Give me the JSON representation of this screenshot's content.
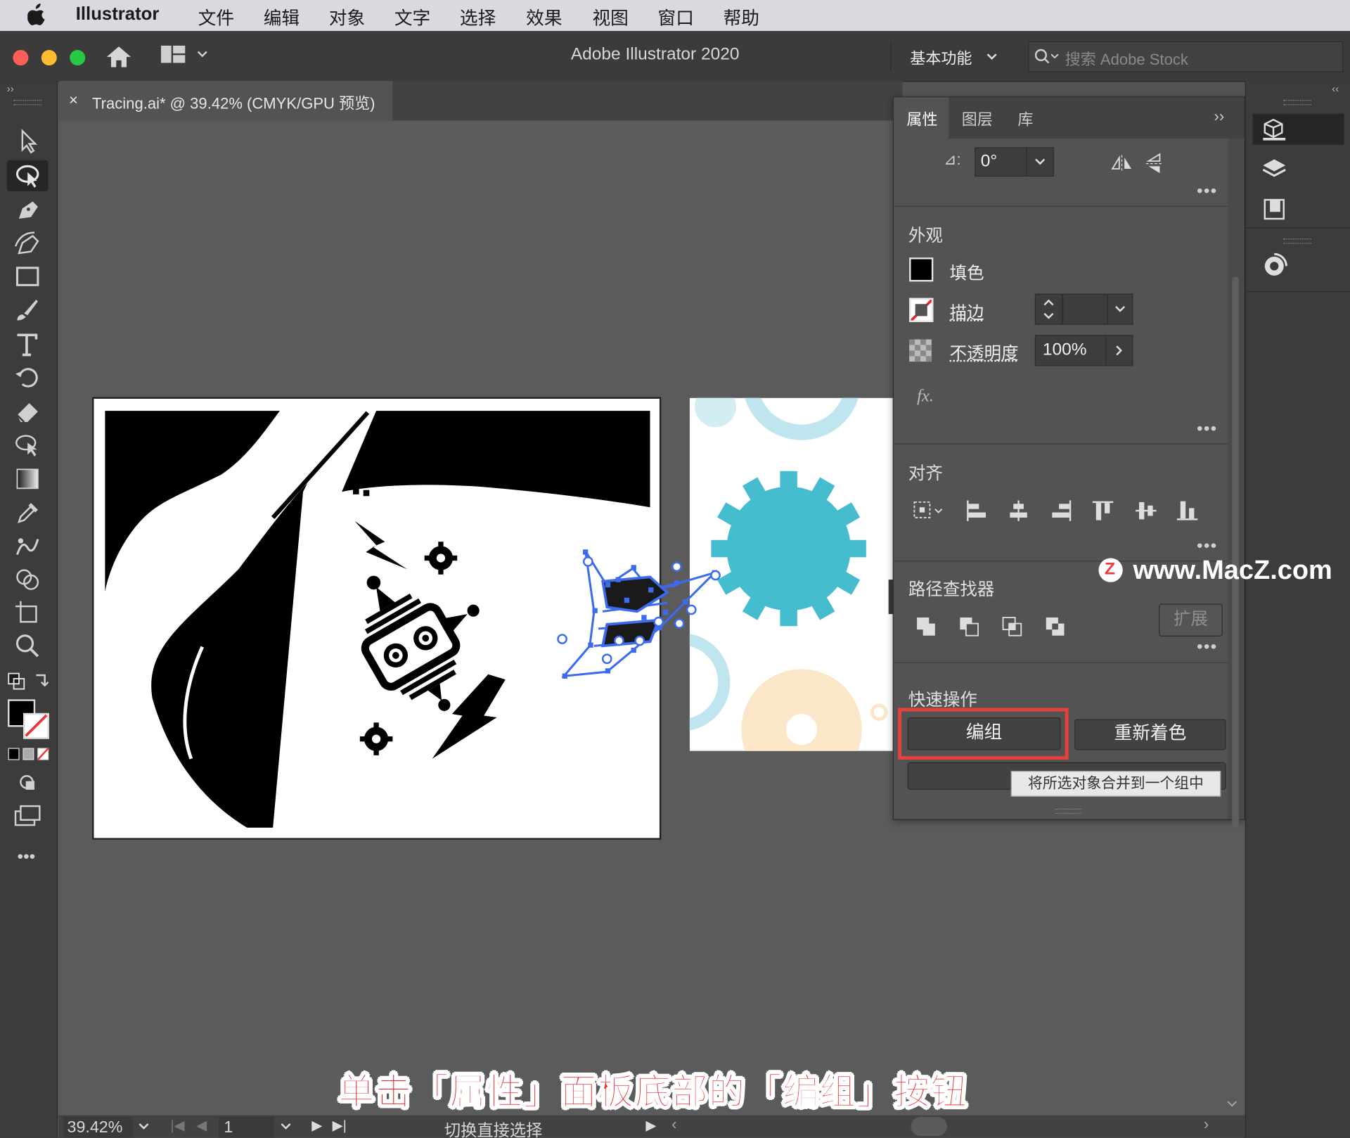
{
  "menubar": {
    "app_name": "Illustrator",
    "items": [
      "文件",
      "编辑",
      "对象",
      "文字",
      "选择",
      "效果",
      "视图",
      "窗口",
      "帮助"
    ]
  },
  "titlebar": {
    "window_title": "Adobe Illustrator 2020",
    "workspace": "基本功能",
    "search_placeholder": "搜索 Adobe Stock"
  },
  "document_tab": {
    "close_symbol": "×",
    "title": "Tracing.ai* @ 39.42% (CMYK/GPU 预览)"
  },
  "properties_panel": {
    "tabs": [
      "属性",
      "图层",
      "库"
    ],
    "active_tab": "属性",
    "rotate_symbol": "⊿:",
    "rotate_value": "0°",
    "appearance": {
      "title": "外观",
      "fill_label": "填色",
      "stroke_label": "描边",
      "opacity_label": "不透明度",
      "opacity_value": "100%",
      "fx_label": "fx."
    },
    "align": {
      "title": "对齐"
    },
    "pathfinder": {
      "title": "路径查找器",
      "expand_label": "扩展"
    },
    "quick_actions": {
      "title": "快速操作",
      "group_button": "编组",
      "recolor_button": "重新着色",
      "tooltip": "将所选对象合并到一个组中"
    },
    "more_symbol": "•••"
  },
  "status_bar": {
    "zoom": "39.42%",
    "artboard_number": "1",
    "status_text": "切换直接选择"
  },
  "overlay": {
    "caption": "单击「属性」面板底部的「编组」按钮",
    "watermark": "www.MacZ.com",
    "watermark_logo": "Z"
  },
  "colors": {
    "highlight_box": "#e8413c",
    "selection_blue": "#3d6bf0",
    "gear_teal": "#46bccf",
    "gear_light": "#bfe6ee",
    "gear_peach": "#fbe6c8"
  }
}
